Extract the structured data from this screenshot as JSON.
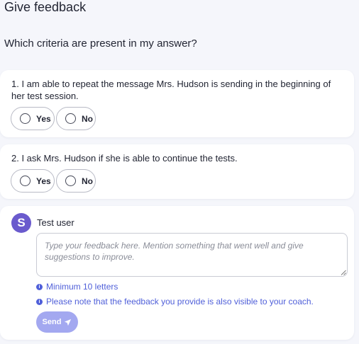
{
  "page": {
    "title": "Give feedback",
    "question_heading": "Which criteria are present in my answer?"
  },
  "questions": [
    {
      "text": "1.  I am able to repeat the message Mrs. Hudson is sending in the beginning of her test session.",
      "options": [
        "Yes",
        "No"
      ]
    },
    {
      "text": "2.  I ask Mrs. Hudson if she is able to continue the tests.",
      "options": [
        "Yes",
        "No"
      ]
    }
  ],
  "feedback": {
    "avatar_letter": "S",
    "user_name": "Test user",
    "placeholder": "Type your feedback here. Mention something that went well and give suggestions to improve.",
    "hint_min": "Minimum 10 letters",
    "hint_visible": "Please note that the feedback you provide is also visible to your coach.",
    "send_label": "Send"
  },
  "colors": {
    "accent": "#4f5fd9",
    "avatar": "#6a5acd",
    "send_disabled": "#a3a8f0",
    "background": "#f5f6fb"
  }
}
